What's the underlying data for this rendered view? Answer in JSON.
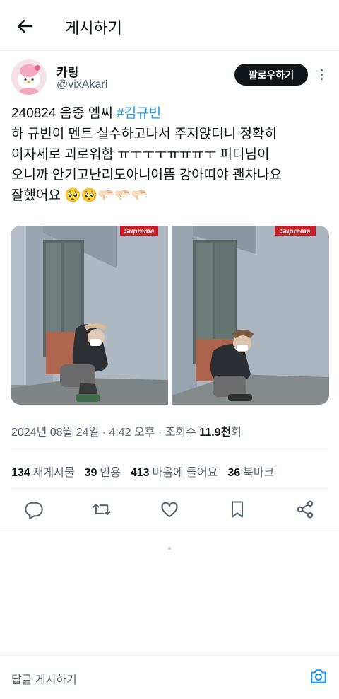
{
  "header": {
    "title": "게시하기",
    "back_icon": "arrow-left-icon"
  },
  "author": {
    "name": "카링",
    "handle": "@vixAkari",
    "follow_label": "팔로우하기"
  },
  "tweet": {
    "line1_prefix": "240824 음중 엠씨 ",
    "hashtag": "#김규빈",
    "line2": "하 규빈이 멘트 실수하고나서 주저앉더니 정확히",
    "line3": "이자세로 괴로워함 ㅠㅜㅜㅜㅠㅠㅠㅜ 피디님이",
    "line4": "오니까 안기고난리도아니어뜸 강아띠야 괜차나요",
    "line5": "잘했어요 🥺🥺🫳🏻🫳🏻🫳🏻"
  },
  "media": {
    "sign_text_1": "Supreme",
    "sign_text_2": "Supreme"
  },
  "meta": {
    "date_time": "2024년 08월 24일 · 4:42 오후 · 조회수 ",
    "views": "11.9천",
    "views_suffix": "회"
  },
  "stats": {
    "retweets_count": "134",
    "retweets_label": "재게시물",
    "quotes_count": "39",
    "quotes_label": "인용",
    "likes_count": "413",
    "likes_label": "마음에 들어요",
    "bookmarks_count": "36",
    "bookmarks_label": "북마크"
  },
  "reply": {
    "placeholder": "답글 게시하기"
  },
  "colors": {
    "accent": "#1d9bf0",
    "text": "#0f1419",
    "secondary": "#536471",
    "divider": "#eff3f4"
  }
}
